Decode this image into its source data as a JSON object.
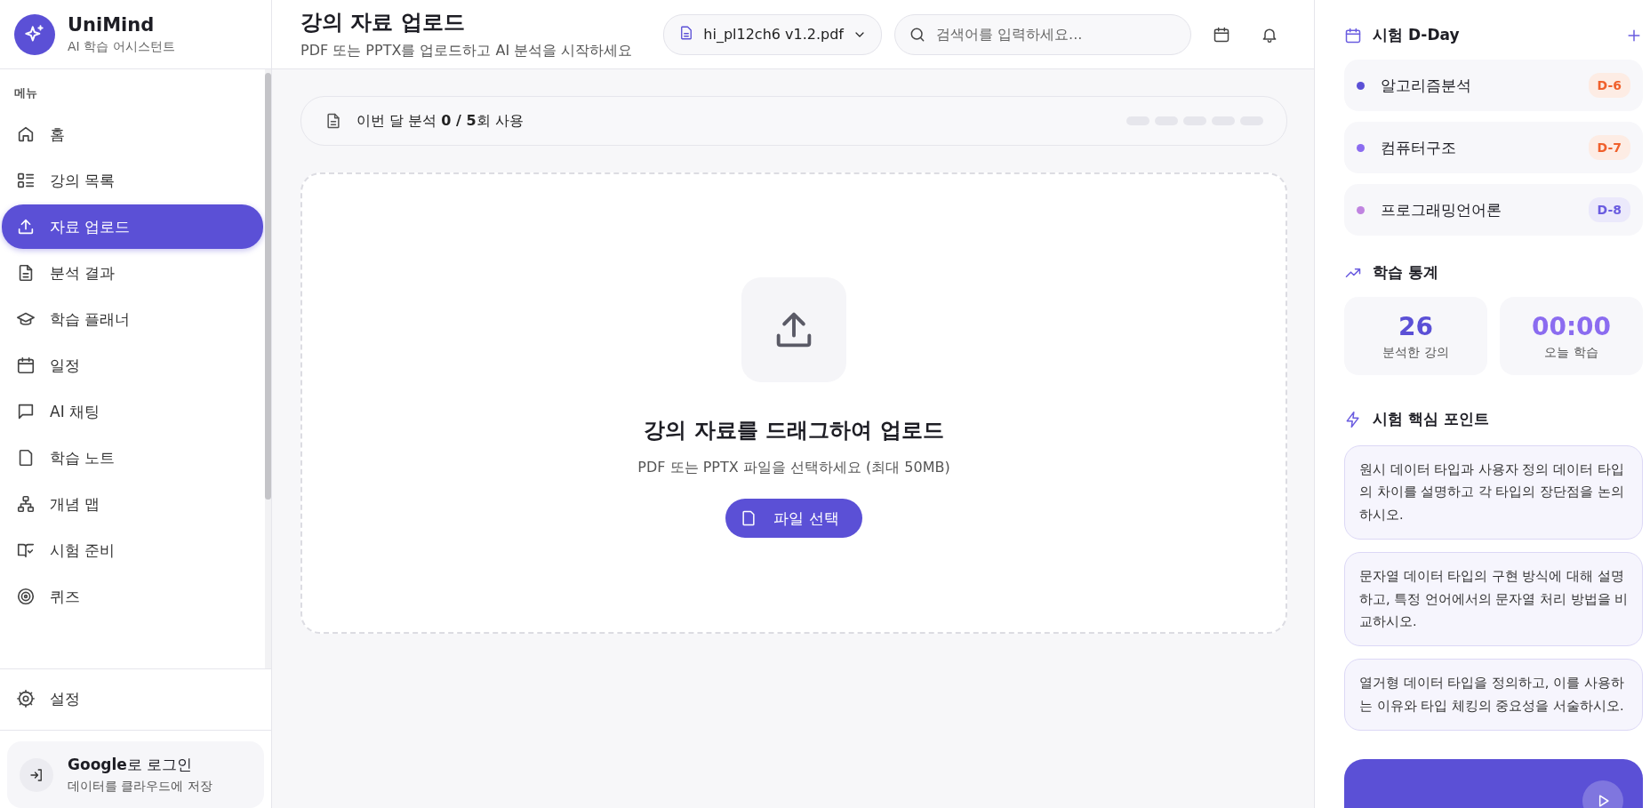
{
  "brand": {
    "name": "UniMind",
    "tagline": "AI 학습 어시스턴트"
  },
  "sidebar": {
    "section_label": "메뉴",
    "items": [
      {
        "label": "홈",
        "selected": false
      },
      {
        "label": "강의 목록",
        "selected": false
      },
      {
        "label": "자료 업로드",
        "selected": true
      },
      {
        "label": "분석 결과",
        "selected": false
      },
      {
        "label": "학습 플래너",
        "selected": false
      },
      {
        "label": "일정",
        "selected": false
      },
      {
        "label": "AI 채팅",
        "selected": false
      },
      {
        "label": "학습 노트",
        "selected": false
      },
      {
        "label": "개념 맵",
        "selected": false
      },
      {
        "label": "시험 준비",
        "selected": false
      },
      {
        "label": "퀴즈",
        "selected": false
      }
    ],
    "settings": "설정",
    "login": {
      "title": "**Google**로 로그인",
      "subtitle": "데이터를 클라우드에 저장"
    }
  },
  "header": {
    "title": "강의 자료 업로드",
    "subtitle": "PDF 또는 PPTX를 업로드하고 AI 분석을 시작하세요",
    "file_select": "hi_pl12ch6 v1.2.pdf",
    "search": {
      "placeholder": "검색어를 입력하세요..."
    }
  },
  "usage": {
    "text": "이번 달 분석 **0 / 5**회 사용"
  },
  "dropzone": {
    "title": "강의 자료를 드래그하여 업로드",
    "hint": "PDF 또는 PPTX 파일을 선택하세요 (최대 50MB)",
    "button": "파일 선택"
  },
  "dday": {
    "title": "시험 D-Day",
    "items": [
      {
        "name": "알고리즘분석",
        "badge": "D-6",
        "color": "#5b50d6",
        "kind": "urgent"
      },
      {
        "name": "컴퓨터구조",
        "badge": "D-7",
        "color": "#8b6cf0",
        "kind": "urgent"
      },
      {
        "name": "프로그래밍언어론",
        "badge": "D-8",
        "color": "#c084e0",
        "kind": "normal"
      }
    ]
  },
  "stats": {
    "title": "학습 통계",
    "items": [
      {
        "value": "26",
        "label": "분석한 강의"
      },
      {
        "value": "00:00",
        "label": "오늘 학습"
      }
    ]
  },
  "key_points": {
    "title": "시험 핵심 포인트",
    "items": [
      "원시 데이터 타입과 사용자 정의 데이터 타입의 차이를 설명하고 각 타입의 장단점을 논의하시오.",
      "문자열 데이터 타입의 구현 방식에 대해 설명하고, 특정 언어에서의 문자열 처리 방법을 비교하시오.",
      "열거형 데이터 타입을 정의하고, 이를 사용하는 이유와 타입 체킹의 중요성을 서술하시오."
    ]
  }
}
